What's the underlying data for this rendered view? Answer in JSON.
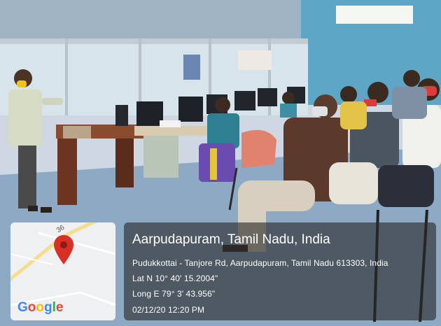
{
  "location": {
    "title": "Aarpudapuram, Tamil Nadu, India",
    "address": "Pudukkottai - Tanjore Rd, Aarpudapuram, Tamil Nadu 613303, India",
    "latitude": "Lat N 10° 40' 15.2004\"",
    "longitude": "Long E 79° 3' 43.956\"",
    "datetime": "02/12/20 12:20 PM"
  },
  "map": {
    "road_number": "36",
    "logo": {
      "text": "Google",
      "colors": [
        "#4285F4",
        "#EA4335",
        "#FBBC05",
        "#4285F4",
        "#34A853",
        "#EA4335"
      ]
    },
    "pin_color": "#d93025"
  },
  "icons": [
    "location-pin-icon",
    "google-logo"
  ]
}
